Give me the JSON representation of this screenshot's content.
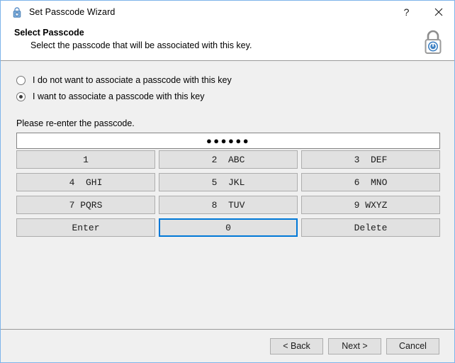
{
  "window": {
    "title": "Set Passcode Wizard",
    "title_icon": "padlock-icon",
    "help_label": "?",
    "close_label": "✕",
    "accent_color": "#0078d7",
    "border_color": "#7eb4ea",
    "body_background": "#f0f0f0",
    "button_face": "#e1e1e1",
    "button_border": "#adadad"
  },
  "header": {
    "title": "Select Passcode",
    "subtitle": "Select the passcode that will be associated with this key.",
    "icon": "padlock-icon",
    "icon_color": "#3f82c4"
  },
  "options": {
    "items": [
      {
        "label": "I do not want to associate a passcode with this key",
        "selected": false
      },
      {
        "label": "I want to associate a passcode with this key",
        "selected": true
      }
    ]
  },
  "passcode": {
    "label": "Please re-enter the passcode.",
    "value": "●●●●●●",
    "placeholder": "",
    "masked_length": 6
  },
  "keypad": {
    "keys": [
      {
        "label": "1",
        "focused": false
      },
      {
        "label": "2  ABC",
        "focused": false
      },
      {
        "label": "3  DEF",
        "focused": false
      },
      {
        "label": "4  GHI",
        "focused": false
      },
      {
        "label": "5  JKL",
        "focused": false
      },
      {
        "label": "6  MNO",
        "focused": false
      },
      {
        "label": "7 PQRS",
        "focused": false
      },
      {
        "label": "8  TUV",
        "focused": false
      },
      {
        "label": "9 WXYZ",
        "focused": false
      },
      {
        "label": "Enter",
        "focused": false
      },
      {
        "label": "0",
        "focused": true
      },
      {
        "label": "Delete",
        "focused": false
      }
    ]
  },
  "footer": {
    "back_label": "< Back",
    "next_label": "Next >",
    "cancel_label": "Cancel"
  }
}
